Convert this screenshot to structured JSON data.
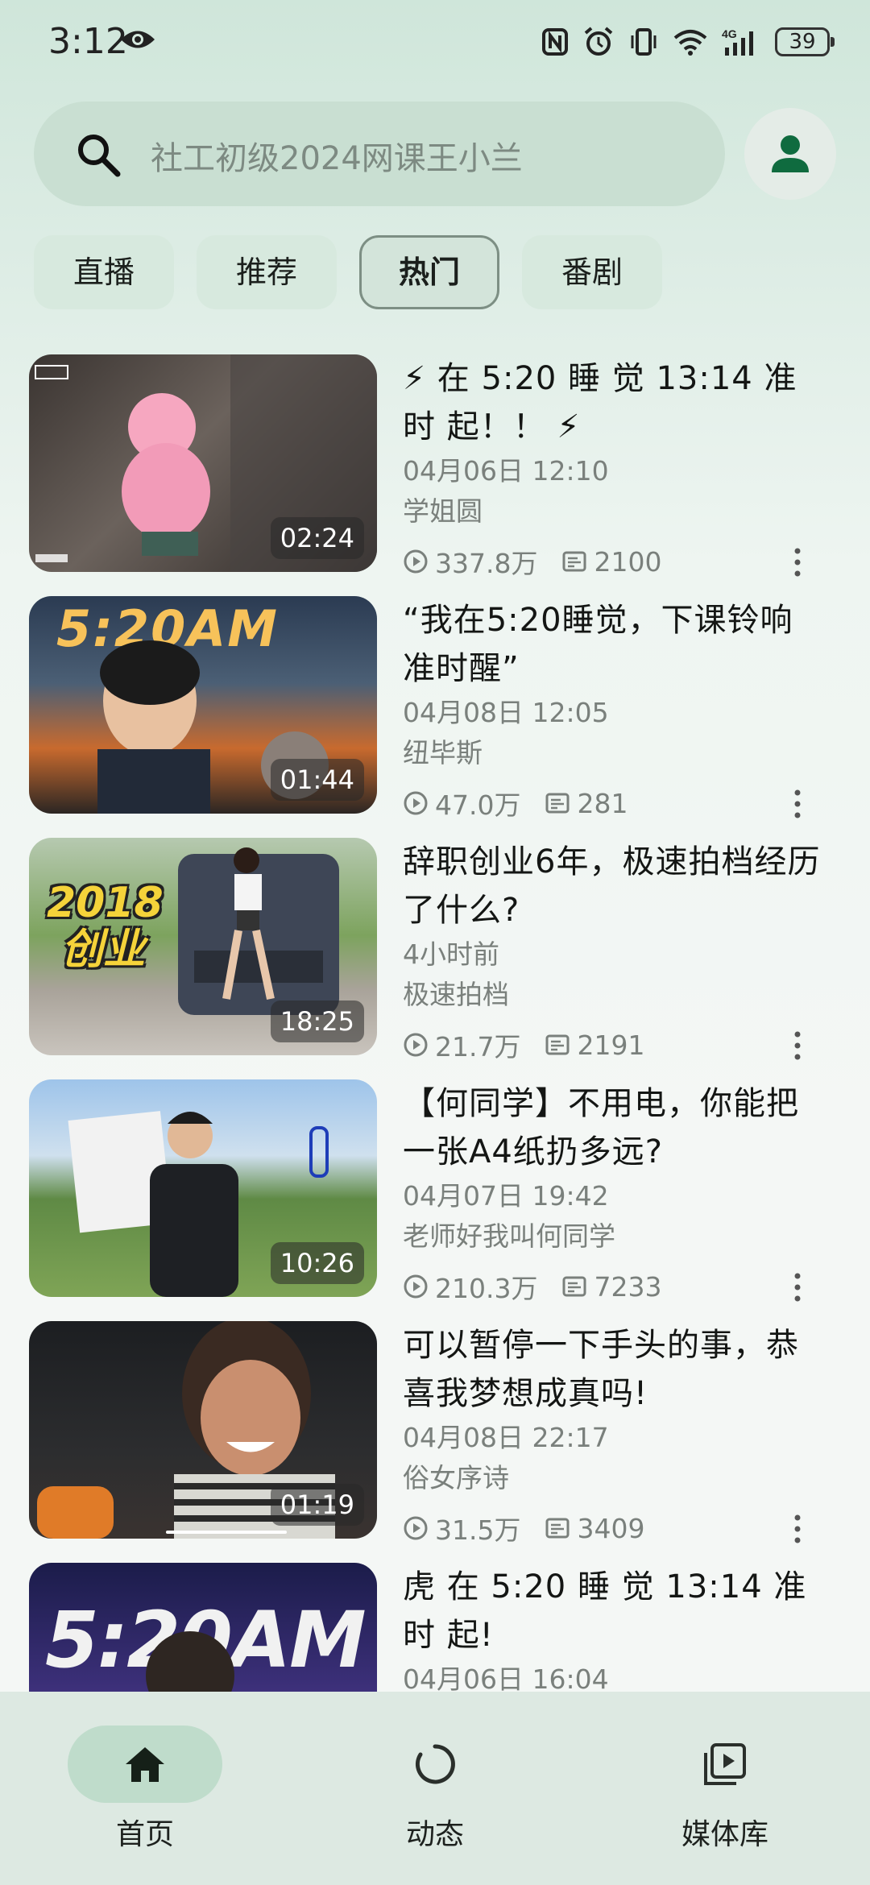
{
  "status_bar": {
    "time": "3:12",
    "battery": "39",
    "icons": [
      "eye-icon",
      "nfc-icon",
      "alarm-icon",
      "vibrate-icon",
      "wifi-icon",
      "signal-4g-icon",
      "battery-icon"
    ]
  },
  "search": {
    "placeholder": "社工初级2024网课王小兰"
  },
  "tabs": [
    {
      "label": "直播"
    },
    {
      "label": "推荐"
    },
    {
      "label": "热门",
      "active": true
    },
    {
      "label": "番剧"
    }
  ],
  "videos": [
    {
      "title": "⚡ 在 5:20 睡 觉 13:14 准 时 起！！ ⚡",
      "date": "04月06日 12:10",
      "channel": "学姐圆",
      "views": "337.8万",
      "comments": "2100",
      "duration": "02:24"
    },
    {
      "title": "“我在5:20睡觉，下课铃响准时醒”",
      "date": "04月08日 12:05",
      "channel": "纽毕斯",
      "views": "47.0万",
      "comments": "281",
      "duration": "01:44",
      "thumb_text": "5:20AM"
    },
    {
      "title": "辞职创业6年，极速拍档经历了什么?",
      "date": "4小时前",
      "channel": "极速拍档",
      "views": "21.7万",
      "comments": "2191",
      "duration": "18:25",
      "thumb_text": "2018 创业"
    },
    {
      "title": "【何同学】不用电，你能把一张A4纸扔多远?",
      "date": "04月07日 19:42",
      "channel": "老师好我叫何同学",
      "views": "210.3万",
      "comments": "7233",
      "duration": "10:26"
    },
    {
      "title": "可以暂停一下手头的事，恭喜我梦想成真吗!",
      "date": "04月08日 22:17",
      "channel": "俗女序诗",
      "views": "31.5万",
      "comments": "3409",
      "duration": "01:19"
    },
    {
      "title": "虎 在 5:20 睡 觉 13:14 准 时 起!",
      "date": "04月06日 16:04",
      "channel": "",
      "views": "",
      "comments": "",
      "duration": "",
      "thumb_text": "5:20AM"
    }
  ],
  "bottom_nav": [
    {
      "label": "首页",
      "icon": "home-icon",
      "active": true
    },
    {
      "label": "动态",
      "icon": "refresh-icon"
    },
    {
      "label": "媒体库",
      "icon": "library-icon"
    }
  ],
  "colors": {
    "accent": "#0f6b3f",
    "tab_bg": "#d7e9de",
    "nav_active": "#bfdccb"
  }
}
